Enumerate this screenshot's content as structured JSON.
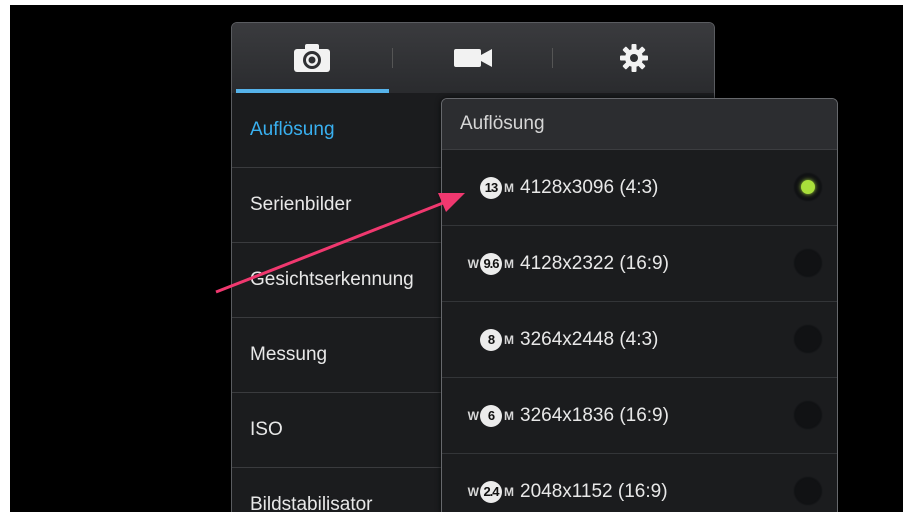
{
  "tabs": [
    {
      "icon": "camera-icon",
      "active": true
    },
    {
      "icon": "video-camera-icon",
      "active": false
    },
    {
      "icon": "gear-icon",
      "active": false
    }
  ],
  "menu": {
    "items": [
      {
        "label": "Auflösung",
        "active": true
      },
      {
        "label": "Serienbilder",
        "active": false
      },
      {
        "label": "Gesichtserkennung",
        "active": false
      },
      {
        "label": "Messung",
        "active": false
      },
      {
        "label": "ISO",
        "active": false
      },
      {
        "label": "Bildstabilisator",
        "active": false
      }
    ]
  },
  "popup": {
    "title": "Auflösung",
    "options": [
      {
        "mp": "13",
        "wide": false,
        "label": "4128x3096 (4:3)",
        "selected": true
      },
      {
        "mp": "9.6",
        "wide": true,
        "label": "4128x2322 (16:9)",
        "selected": false
      },
      {
        "mp": "8",
        "wide": false,
        "label": "3264x2448 (4:3)",
        "selected": false
      },
      {
        "mp": "6",
        "wide": true,
        "label": "3264x1836 (16:9)",
        "selected": false
      },
      {
        "mp": "2.4",
        "wide": true,
        "label": "2048x1152 (16:9)",
        "selected": false
      }
    ]
  },
  "colors": {
    "accent_blue": "#39b0f0",
    "tab_indicator": "#56b3ea",
    "selected_radio": "#a9df3b",
    "arrow": "#f0386f"
  }
}
